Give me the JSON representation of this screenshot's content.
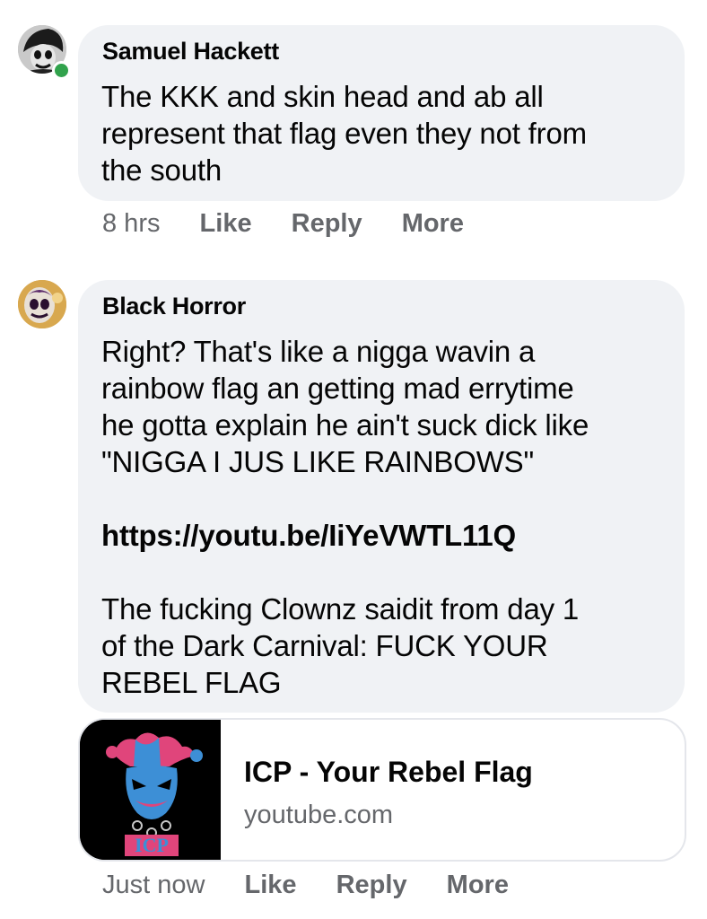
{
  "comments": [
    {
      "author": "Samuel Hackett",
      "avatar": "clown-face-avatar",
      "online": true,
      "text_lines": [
        "The KKK and skin head and ab all",
        "represent that flag even they not from",
        "the south"
      ],
      "time": "8 hrs",
      "actions": [
        "Like",
        "Reply",
        "More"
      ]
    },
    {
      "author": "Black Horror",
      "avatar": "clown-face-avatar",
      "paragraph1": [
        "Right? That's like a nigga wavin a",
        "rainbow flag an getting mad errytime",
        "he gotta explain he ain't suck dick like",
        "\"NIGGA I JUS LIKE RAINBOWS\""
      ],
      "link": "https://youtu.be/IiYeVWTL11Q",
      "paragraph2": [
        "The fucking Clownz saidit from day 1",
        "of the Dark Carnival: FUCK YOUR",
        "REBEL FLAG"
      ],
      "link_preview": {
        "title": "ICP - Your Rebel Flag",
        "domain": "youtube.com",
        "thumbnail": "icp-jester-logo",
        "thumbnail_text": "ICP"
      },
      "time": "Just now",
      "actions": [
        "Like",
        "Reply",
        "More"
      ]
    }
  ],
  "colors": {
    "bubble": "#f0f2f5",
    "meta_text": "#65676b",
    "online_dot": "#31a24c",
    "jester_pink": "#e0457b",
    "jester_blue": "#3d8fd6"
  }
}
